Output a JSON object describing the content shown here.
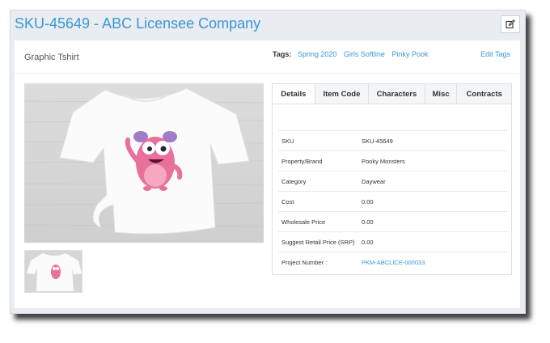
{
  "header": {
    "title": "SKU-45649 - ABC Licensee Company",
    "edit_icon": "pencil-square-icon"
  },
  "product": {
    "name": "Graphic Tshirt"
  },
  "tags": {
    "label": "Tags:",
    "items": [
      "Spring 2020",
      "Girls Softline",
      "Pinky Pook"
    ],
    "edit_label": "Edit Tags"
  },
  "tabs": [
    {
      "label": "Details",
      "active": true
    },
    {
      "label": "Item Code",
      "active": false
    },
    {
      "label": "Characters",
      "active": false
    },
    {
      "label": "Misc",
      "active": false
    },
    {
      "label": "Contracts",
      "active": false
    }
  ],
  "details": [
    {
      "key": "SKU",
      "value": "SKU-45649"
    },
    {
      "key": "Property/Brand",
      "value": "Pooky Monsters"
    },
    {
      "key": "Category",
      "value": "Daywear"
    },
    {
      "key": "Cost",
      "value": "0.00"
    },
    {
      "key": "Wholesale Price",
      "value": "0.00"
    },
    {
      "key": "Suggest Retail Price (SRP)",
      "value": "0.00"
    },
    {
      "key": "Project Number :",
      "value": "PKM-ABCLICE-000033",
      "link": true
    }
  ],
  "colors": {
    "accent": "#3a97d6",
    "monster_pink": "#e8709a"
  }
}
